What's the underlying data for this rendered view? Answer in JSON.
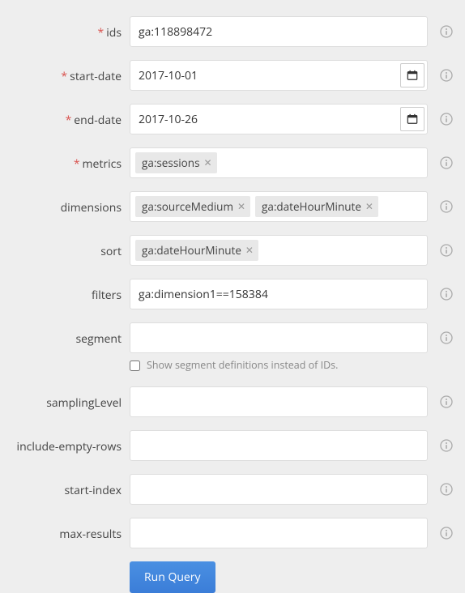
{
  "fields": {
    "ids": {
      "label": "ids",
      "required": true,
      "value": "ga:118898472"
    },
    "start_date": {
      "label": "start-date",
      "required": true,
      "value": "2017-10-01"
    },
    "end_date": {
      "label": "end-date",
      "required": true,
      "value": "2017-10-26"
    },
    "metrics": {
      "label": "metrics",
      "required": true,
      "tags": [
        "ga:sessions"
      ]
    },
    "dimensions": {
      "label": "dimensions",
      "required": false,
      "tags": [
        "ga:sourceMedium",
        "ga:dateHourMinute"
      ]
    },
    "sort": {
      "label": "sort",
      "required": false,
      "tags": [
        "ga:dateHourMinute"
      ]
    },
    "filters": {
      "label": "filters",
      "required": false,
      "value": "ga:dimension1==158384"
    },
    "segment": {
      "label": "segment",
      "required": false,
      "value": ""
    },
    "segment_checkbox": {
      "label": "Show segment definitions instead of IDs.",
      "checked": false
    },
    "samplingLevel": {
      "label": "samplingLevel",
      "required": false,
      "value": ""
    },
    "include_empty_rows": {
      "label": "include-empty-rows",
      "required": false,
      "value": ""
    },
    "start_index": {
      "label": "start-index",
      "required": false,
      "value": ""
    },
    "max_results": {
      "label": "max-results",
      "required": false,
      "value": ""
    }
  },
  "buttons": {
    "run_query": "Run Query"
  }
}
